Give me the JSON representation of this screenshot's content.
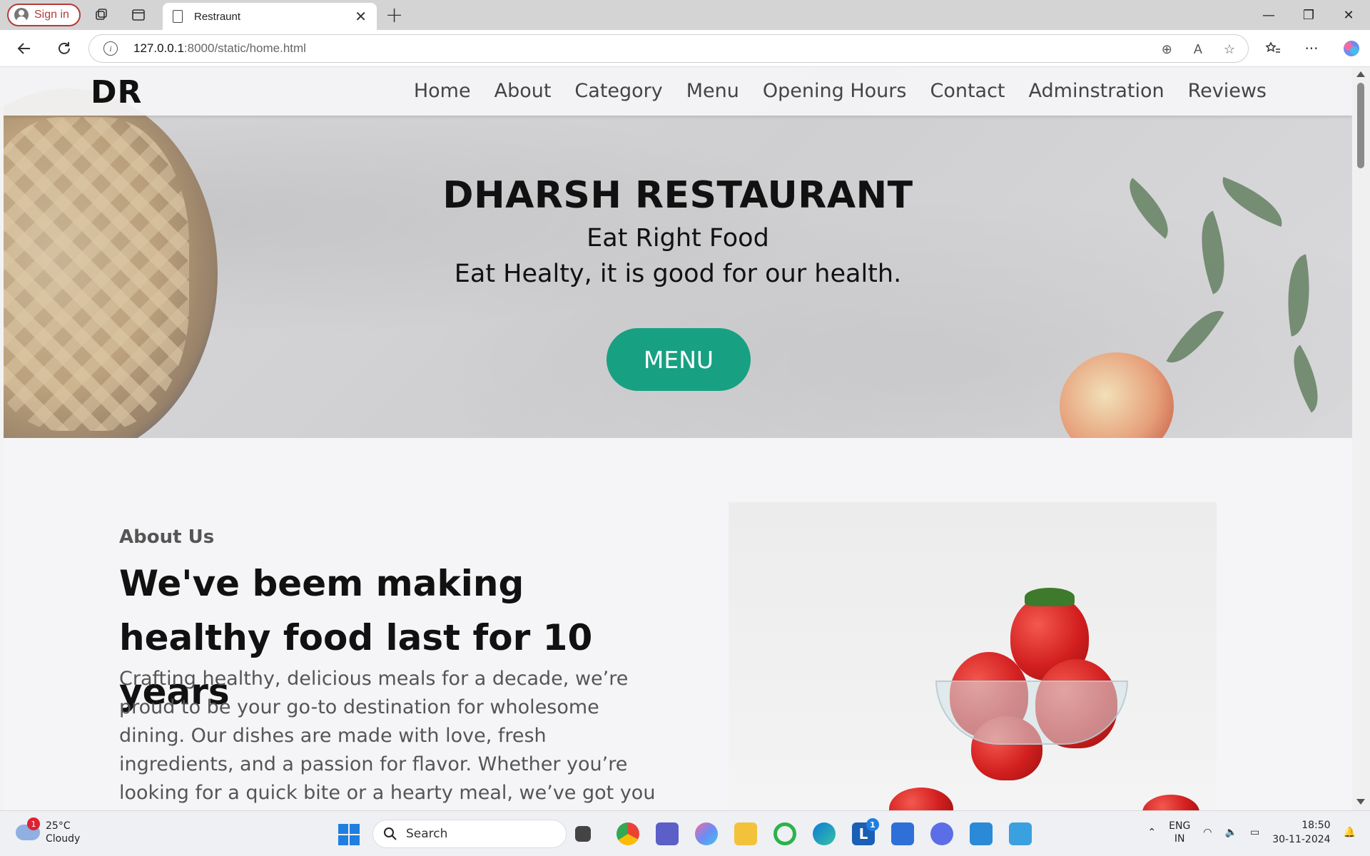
{
  "browser": {
    "signin_label": "Sign in",
    "tab_title": "Restraunt",
    "url_host": "127.0.0.1",
    "url_path": ":8000/static/home.html"
  },
  "site": {
    "logo": "DR",
    "nav": [
      "Home",
      "About",
      "Category",
      "Menu",
      "Opening Hours",
      "Contact",
      "Adminstration",
      "Reviews"
    ],
    "hero": {
      "title": "DHARSH RESTAURANT",
      "subtitle1": "Eat Right Food",
      "subtitle2": "Eat Healty, it is good for our health.",
      "cta": "MENU"
    },
    "about": {
      "kicker": "About Us",
      "title": "We've beem making healthy food last for 10 years",
      "body": "Crafting healthy, delicious meals for a decade, we’re proud to be your go-to destination for wholesome dining. Our dishes are made with love, fresh ingredients, and a passion for flavor. Whether you’re looking for a quick bite or a hearty meal, we’ve got you covered."
    },
    "colors": {
      "accent": "#18a083"
    }
  },
  "taskbar": {
    "weather_temp": "25°C",
    "weather_desc": "Cloudy",
    "weather_badge": "1",
    "search_label": "Search",
    "lang_line1": "ENG",
    "lang_line2": "IN",
    "time": "18:50",
    "date": "30-11-2024",
    "app_badge": "1"
  }
}
